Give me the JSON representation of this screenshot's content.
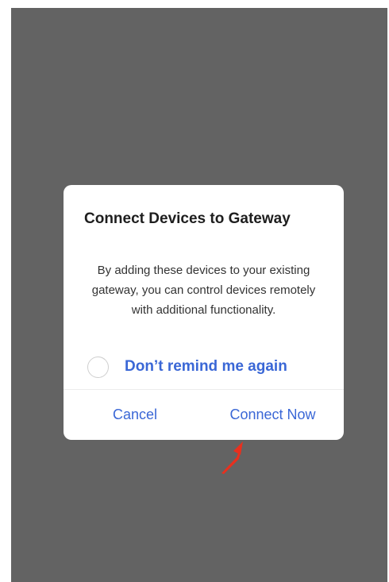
{
  "dialog": {
    "title": "Connect Devices to Gateway",
    "message": "By adding these devices to your existing gateway, you can control devices remotely with additional functionality.",
    "remind_label": "Don’t remind me again",
    "remind_checked": false,
    "cancel_label": "Cancel",
    "connect_label": "Connect Now"
  },
  "colors": {
    "overlay": "#636363",
    "accent": "#3a67d6",
    "annotation_arrow": "#e8301e"
  },
  "annotation": {
    "icon": "red-arrow-icon",
    "points_to": "connect-now-button"
  }
}
